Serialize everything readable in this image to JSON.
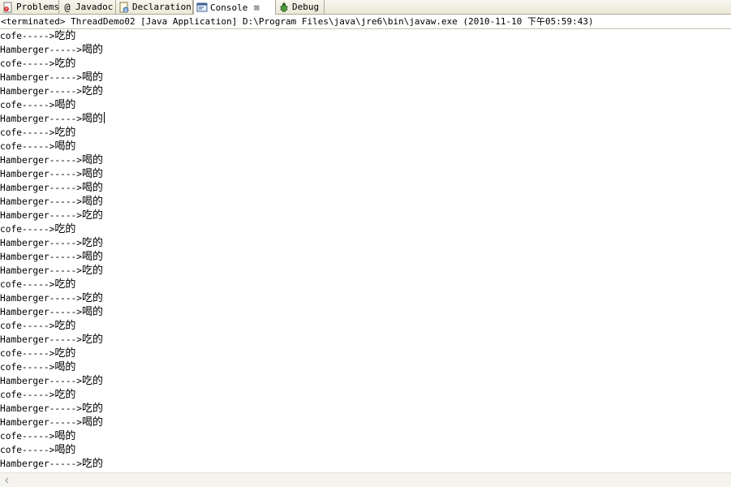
{
  "tabs": [
    {
      "label": "Problems",
      "icon": "problems-icon",
      "active": false
    },
    {
      "label": "Javadoc",
      "icon": "at-icon",
      "active": false
    },
    {
      "label": "Declaration",
      "icon": "declaration-icon",
      "active": false
    },
    {
      "label": "Console",
      "icon": "console-icon",
      "active": true,
      "close": "⊠"
    },
    {
      "label": "Debug",
      "icon": "bug-icon",
      "active": false
    }
  ],
  "javadoc_glyph": "@",
  "status": "<terminated> ThreadDemo02 [Java Application] D:\\Program Files\\java\\jre6\\bin\\javaw.exe (2010-11-10 下午05:59:43)",
  "console_lines": [
    {
      "k": "cofe----->",
      "v": "吃的"
    },
    {
      "k": "Hamberger----->",
      "v": "喝的"
    },
    {
      "k": "cofe----->",
      "v": "吃的"
    },
    {
      "k": "Hamberger----->",
      "v": "喝的"
    },
    {
      "k": "Hamberger----->",
      "v": "吃的"
    },
    {
      "k": "cofe----->",
      "v": "喝的"
    },
    {
      "k": "Hamberger----->",
      "v": "喝的"
    },
    {
      "k": "cofe----->",
      "v": "吃的"
    },
    {
      "k": "cofe----->",
      "v": "喝的"
    },
    {
      "k": "Hamberger----->",
      "v": "喝的"
    },
    {
      "k": "Hamberger----->",
      "v": "喝的"
    },
    {
      "k": "Hamberger----->",
      "v": "喝的"
    },
    {
      "k": "Hamberger----->",
      "v": "喝的"
    },
    {
      "k": "Hamberger----->",
      "v": "吃的"
    },
    {
      "k": "cofe----->",
      "v": "吃的"
    },
    {
      "k": "Hamberger----->",
      "v": "吃的"
    },
    {
      "k": "Hamberger----->",
      "v": "喝的"
    },
    {
      "k": "Hamberger----->",
      "v": "吃的"
    },
    {
      "k": "cofe----->",
      "v": "吃的"
    },
    {
      "k": "Hamberger----->",
      "v": "吃的"
    },
    {
      "k": "Hamberger----->",
      "v": "喝的"
    },
    {
      "k": "cofe----->",
      "v": "吃的"
    },
    {
      "k": "Hamberger----->",
      "v": "吃的"
    },
    {
      "k": "cofe----->",
      "v": "吃的"
    },
    {
      "k": "cofe----->",
      "v": "喝的"
    },
    {
      "k": "Hamberger----->",
      "v": "吃的"
    },
    {
      "k": "cofe----->",
      "v": "吃的"
    },
    {
      "k": "Hamberger----->",
      "v": "吃的"
    },
    {
      "k": "Hamberger----->",
      "v": "喝的"
    },
    {
      "k": "cofe----->",
      "v": "喝的"
    },
    {
      "k": "cofe----->",
      "v": "喝的"
    },
    {
      "k": "Hamberger----->",
      "v": "吃的"
    }
  ],
  "caret_line_index": 6,
  "colors": {
    "tabbar_bg": "#ece9d8",
    "tab_border": "#aca899",
    "text": "#000000",
    "console_bg": "#ffffff"
  }
}
